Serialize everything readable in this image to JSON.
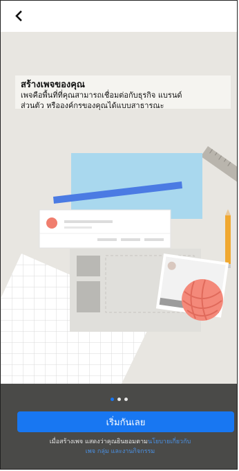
{
  "header": {
    "back_icon": "chevron-left-icon"
  },
  "intro": {
    "title": "สร้างเพจของคุณ",
    "description_line1": "เพจคือพื้นที่ที่คุณสามารถเชื่อมต่อกับธุรกิจ แบรนด์",
    "description_line2": "ส่วนตัว หรือองค์กรของคุณได้แบบสาธารณะ"
  },
  "pager": {
    "count": 3,
    "active_index": 0
  },
  "cta": {
    "label": "เริ่มกันเลย"
  },
  "terms": {
    "prefix": "เมื่อสร้างเพจ แสดงว่าคุณยินยอมตาม",
    "link1": "นโยบายเกี่ยวกับ",
    "link2": "เพจ กลุ่ม และงานกิจกรรม"
  },
  "colors": {
    "accent": "#1877f2",
    "link": "#4a90e2",
    "bottom_panel": "#4a4a48"
  }
}
